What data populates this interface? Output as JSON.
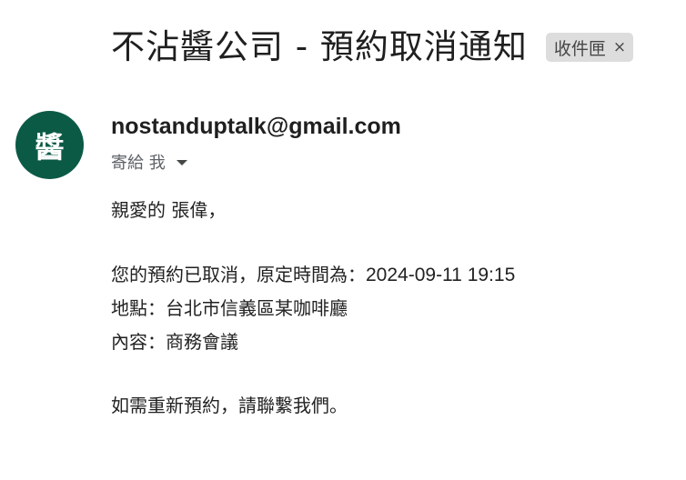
{
  "email": {
    "subject": "不沾醬公司 - 預約取消通知",
    "label": "收件匣",
    "label_close": "×",
    "avatar_text": "醬",
    "sender": "nostanduptalk@gmail.com",
    "recipient_text": "寄給 我",
    "body": {
      "greeting": "親愛的 張偉，",
      "line1_prefix": "您的預約已取消，原定時間為：",
      "line1_datetime": "2024-09-11 19:15",
      "line2": "地點：台北市信義區某咖啡廳",
      "line3": "內容：商務會議",
      "closing": "如需重新預約，請聯繫我們。"
    }
  },
  "colors": {
    "avatar_bg": "#0b5a46",
    "chip_bg": "#dddddd",
    "text": "#202124"
  }
}
